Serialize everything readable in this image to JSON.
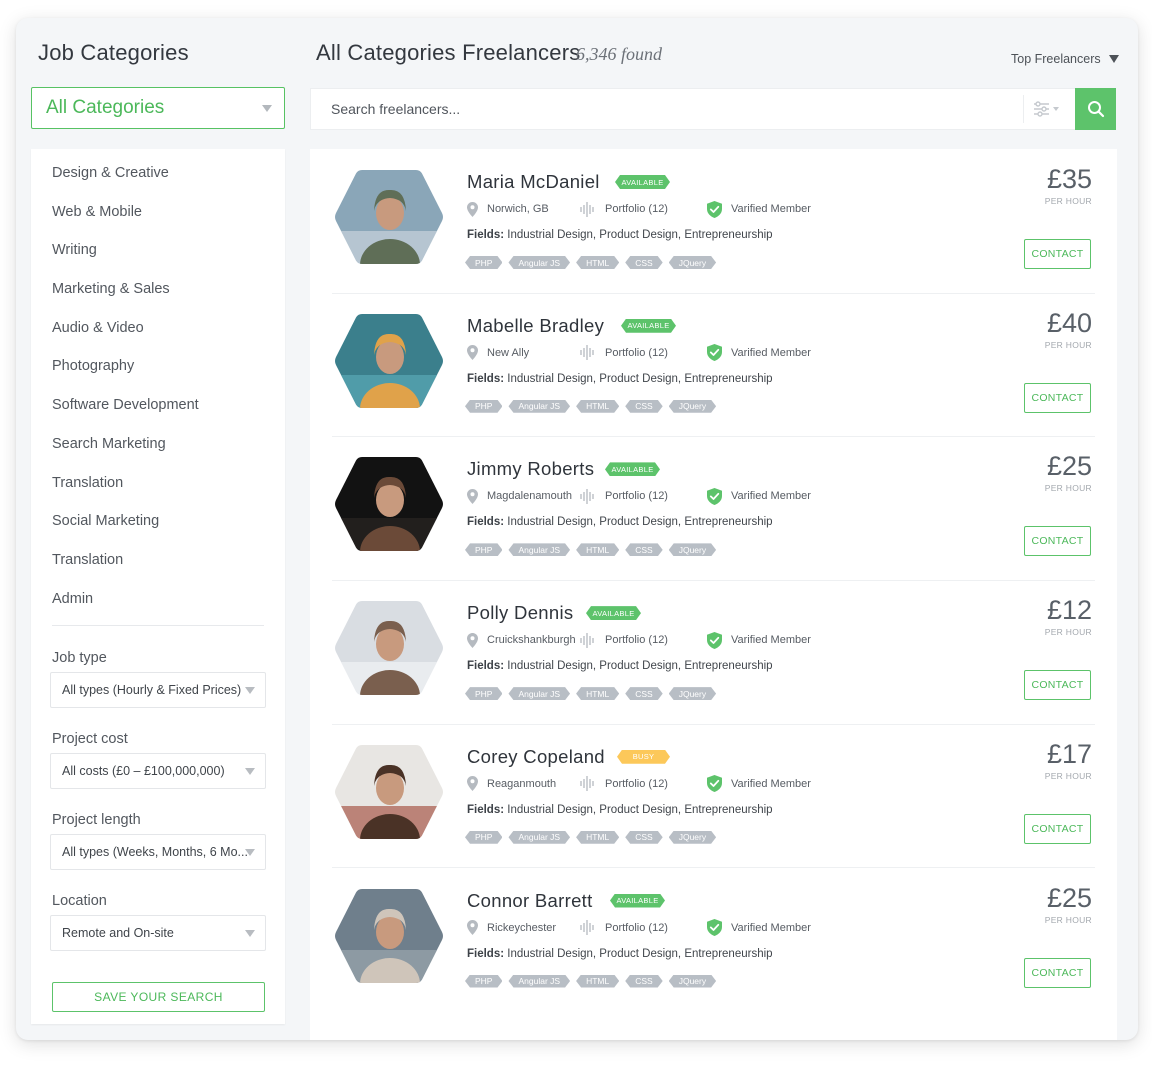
{
  "sidebar": {
    "title": "Job Categories",
    "category_select": "All Categories",
    "categories": [
      "Design & Creative",
      "Web & Mobile",
      "Writing",
      "Marketing & Sales",
      "Audio & Video",
      "Photography",
      "Software Development",
      "Search Marketing",
      "Translation",
      "Social Marketing",
      "Translation",
      "Admin"
    ],
    "filters": {
      "job_type": {
        "label": "Job type",
        "value": "All types (Hourly & Fixed Prices)"
      },
      "project_cost": {
        "label": "Project cost",
        "value": "All costs (£0 – £100,000,000)"
      },
      "project_length": {
        "label": "Project length",
        "value": "All types (Weeks, Months, 6 Mo..."
      },
      "location": {
        "label": "Location",
        "value": "Remote and On-site"
      }
    },
    "save_search": "SAVE YOUR SEARCH"
  },
  "header": {
    "title": "All Categories Freelancers",
    "found": "6,346 found",
    "sort": "Top Freelancers",
    "search_placeholder": "Search freelancers..."
  },
  "colors": {
    "accent_green": "#5dc36b",
    "busy_yellow": "#fcc85a",
    "tag_grey": "#b8bec5"
  },
  "freelancers": [
    {
      "name": "Maria McDaniel",
      "status": "AVAILABLE",
      "location": "Norwich, GB",
      "portfolio": "Portfolio (12)",
      "verified": "Varified Member",
      "fields_label": "Fields:",
      "fields": "Industrial Design, Product Design, Entrepreneurship",
      "tags": [
        "PHP",
        "Angular JS",
        "HTML",
        "CSS",
        "JQuery"
      ],
      "price": "£35",
      "per": "PER HOUR",
      "contact": "CONTACT"
    },
    {
      "name": "Mabelle Bradley",
      "status": "AVAILABLE",
      "location": "New Ally",
      "portfolio": "Portfolio (12)",
      "verified": "Varified Member",
      "fields_label": "Fields:",
      "fields": "Industrial Design, Product Design, Entrepreneurship",
      "tags": [
        "PHP",
        "Angular JS",
        "HTML",
        "CSS",
        "JQuery"
      ],
      "price": "£40",
      "per": "PER HOUR",
      "contact": "CONTACT"
    },
    {
      "name": "Jimmy Roberts",
      "status": "AVAILABLE",
      "location": "Magdalenamouth",
      "portfolio": "Portfolio (12)",
      "verified": "Varified Member",
      "fields_label": "Fields:",
      "fields": "Industrial Design, Product Design, Entrepreneurship",
      "tags": [
        "PHP",
        "Angular JS",
        "HTML",
        "CSS",
        "JQuery"
      ],
      "price": "£25",
      "per": "PER HOUR",
      "contact": "CONTACT"
    },
    {
      "name": "Polly Dennis",
      "status": "AVAILABLE",
      "location": "Cruickshankburgh",
      "portfolio": "Portfolio (12)",
      "verified": "Varified Member",
      "fields_label": "Fields:",
      "fields": "Industrial Design, Product Design, Entrepreneurship",
      "tags": [
        "PHP",
        "Angular JS",
        "HTML",
        "CSS",
        "JQuery"
      ],
      "price": "£12",
      "per": "PER HOUR",
      "contact": "CONTACT"
    },
    {
      "name": "Corey Copeland",
      "status": "BUSY",
      "location": "Reaganmouth",
      "portfolio": "Portfolio (12)",
      "verified": "Varified Member",
      "fields_label": "Fields:",
      "fields": "Industrial Design, Product Design, Entrepreneurship",
      "tags": [
        "PHP",
        "Angular JS",
        "HTML",
        "CSS",
        "JQuery"
      ],
      "price": "£17",
      "per": "PER HOUR",
      "contact": "CONTACT"
    },
    {
      "name": "Connor Barrett",
      "status": "AVAILABLE",
      "location": "Rickeychester",
      "portfolio": "Portfolio (12)",
      "verified": "Varified Member",
      "fields_label": "Fields:",
      "fields": "Industrial Design, Product Design, Entrepreneurship",
      "tags": [
        "PHP",
        "Angular JS",
        "HTML",
        "CSS",
        "JQuery"
      ],
      "price": "£25",
      "per": "PER HOUR",
      "contact": "CONTACT"
    }
  ]
}
